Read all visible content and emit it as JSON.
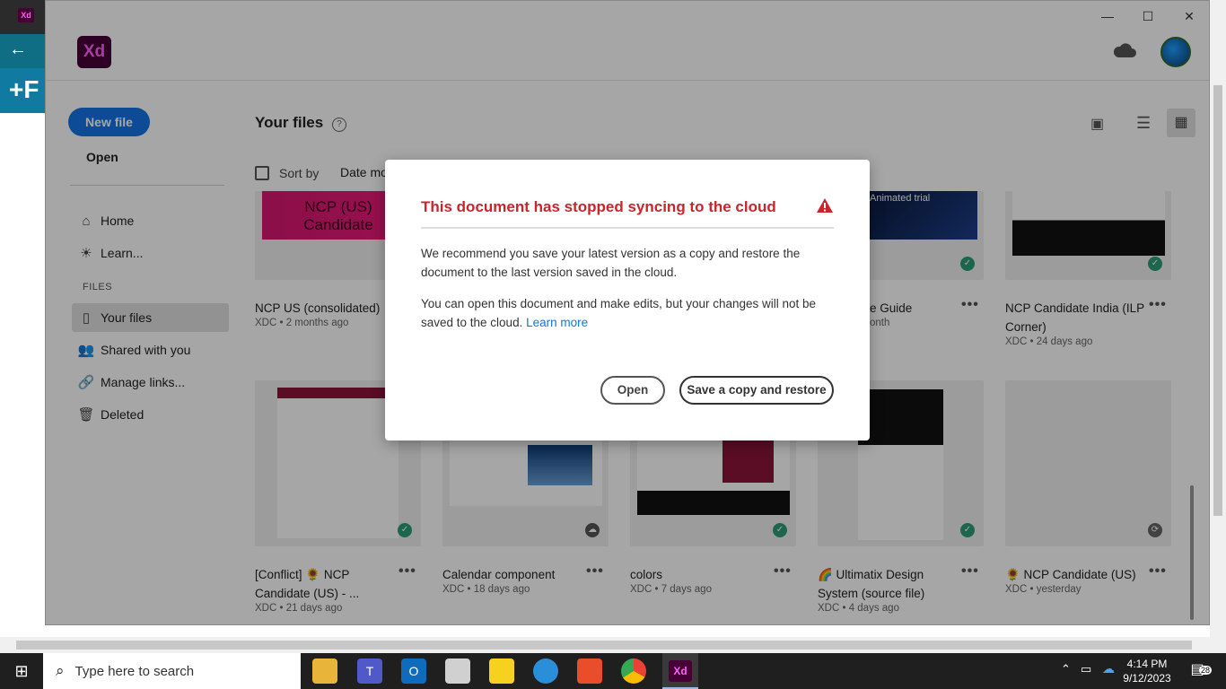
{
  "window": {
    "minimize": "—",
    "maximize": "☐",
    "close": "✕",
    "logo": "Xd"
  },
  "background": {
    "tab_icon": "Xd",
    "blue_tile": "+F",
    "back_arrow": "←"
  },
  "sidebar": {
    "new_file": "New file",
    "open": "Open",
    "items": [
      {
        "label": "Home",
        "icon": "home-icon",
        "glyph": "⌂"
      },
      {
        "label": "Learn...",
        "icon": "lightbulb-icon",
        "glyph": "☀"
      }
    ],
    "files_heading": "FILES",
    "file_items": [
      {
        "label": "Your files",
        "icon": "document-icon",
        "glyph": "▯"
      },
      {
        "label": "Shared with you",
        "icon": "people-icon",
        "glyph": "👥"
      },
      {
        "label": "Manage links...",
        "icon": "link-icon",
        "glyph": "🔗"
      },
      {
        "label": "Deleted",
        "icon": "trash-icon",
        "glyph": "🗑"
      }
    ]
  },
  "main": {
    "title": "Your files",
    "help": "?",
    "sort_by": "Sort by",
    "sort_value": "Date mo",
    "cards_row1": [
      {
        "name": "NCP US (consolidated)",
        "meta": "XDC • 2 months ago",
        "thumb_text": "NCP (US)\nCandidate"
      },
      {
        "name": "e Guide",
        "meta": "onth",
        "thumb_text": "Animated trial"
      },
      {
        "name": "NCP Candidate India (ILP Corner)",
        "meta": "XDC • 24 days ago"
      }
    ],
    "cards_row2": [
      {
        "name": "[Conflict] 🌻 NCP Candidate (US) - ...",
        "meta": "XDC • 21 days ago"
      },
      {
        "name": "Calendar component",
        "meta": "XDC • 18 days ago"
      },
      {
        "name": "colors",
        "meta": "XDC • 7 days ago"
      },
      {
        "name": "🌈 Ultimatix Design System (source file)",
        "meta": "XDC • 4 days ago"
      },
      {
        "name": "🌻 NCP Candidate (US)",
        "meta": "XDC • yesterday"
      }
    ],
    "dots": "•••"
  },
  "dialog": {
    "title": "This document has stopped syncing to the cloud",
    "p1": "We recommend you save your latest version as a copy and restore the document to the last version saved in the cloud.",
    "p2": "You can open this document and make edits, but your changes will not be saved to the cloud.",
    "learn_more": "Learn more",
    "open_button": "Open",
    "save_button": "Save a copy and restore"
  },
  "taskbar": {
    "search_placeholder": "Type here to search",
    "time": "4:14 PM",
    "date": "9/12/2023",
    "notifications": "28",
    "xd_label": "Xd"
  },
  "colors": {
    "accent": "#1473e6",
    "error": "#c9252d",
    "xd_bg": "#470137",
    "xd_fg": "#ff61f6",
    "success": "#2d9d78"
  }
}
